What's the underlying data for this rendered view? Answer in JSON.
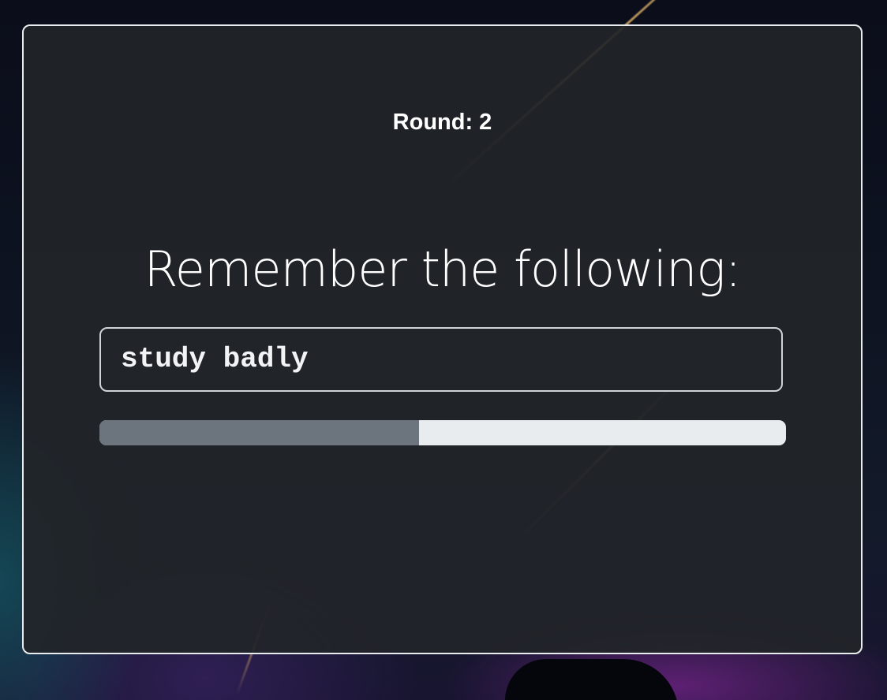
{
  "game": {
    "round_label": "Round: 2",
    "prompt": "Remember the following:",
    "phrase": "study badly",
    "timer_progress_percent": 46.5
  },
  "colors": {
    "card_background": "#212529",
    "card_border": "#e9ecef",
    "progress_fill": "#6c757d",
    "progress_track": "#e9ecef"
  }
}
